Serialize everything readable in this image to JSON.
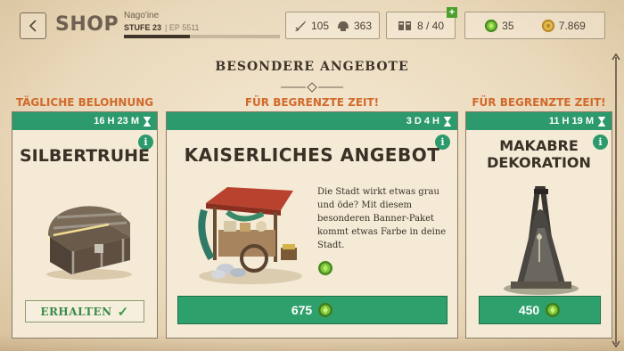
{
  "header": {
    "back_icon": "chevron-left-icon",
    "title": "SHOP",
    "player_name": "Nago'ine",
    "level_label": "STUFE 23",
    "ep_label": "EP 5511",
    "xp_progress": 0.42
  },
  "stats": {
    "military_left_icon": "sword-icon",
    "military_left_value": "105",
    "military_right_icon": "helmet-icon",
    "military_right_value": "363",
    "build_icon": "building-queue-icon",
    "build_value": "8 / 40",
    "plus_label": "+",
    "gems_icon": "gem-icon",
    "gems_value": "35",
    "coins_icon": "coin-icon",
    "coins_value": "7.869"
  },
  "section": {
    "title": "BESONDERE ANGEBOTE"
  },
  "cards": [
    {
      "tag": "TÄGLICHE BELOHNUNG",
      "timer": "16 H 23 M",
      "info": "i",
      "title": "SILBERTRUHE",
      "action_label": "ERHALTEN",
      "action_check": "✓"
    },
    {
      "tag": "FÜR BEGRENZTE ZEIT!",
      "timer": "3 D 4 H",
      "info": "i",
      "title": "KAISERLICHES ANGEBOT",
      "description": "Die Stadt wirkt etwas grau und öde? Mit diesem besonderen Banner-Paket kommt etwas Farbe in deine Stadt.",
      "price": "675"
    },
    {
      "tag": "FÜR BEGRENZTE ZEIT!",
      "timer": "11 H 19 M",
      "info": "i",
      "title_line1": "MAKABRE",
      "title_line2": "DEKORATION",
      "price": "450"
    }
  ],
  "colors": {
    "accent_green": "#2c9a6c",
    "tag_orange": "#d2692a",
    "parchment": "#f4ead6"
  }
}
